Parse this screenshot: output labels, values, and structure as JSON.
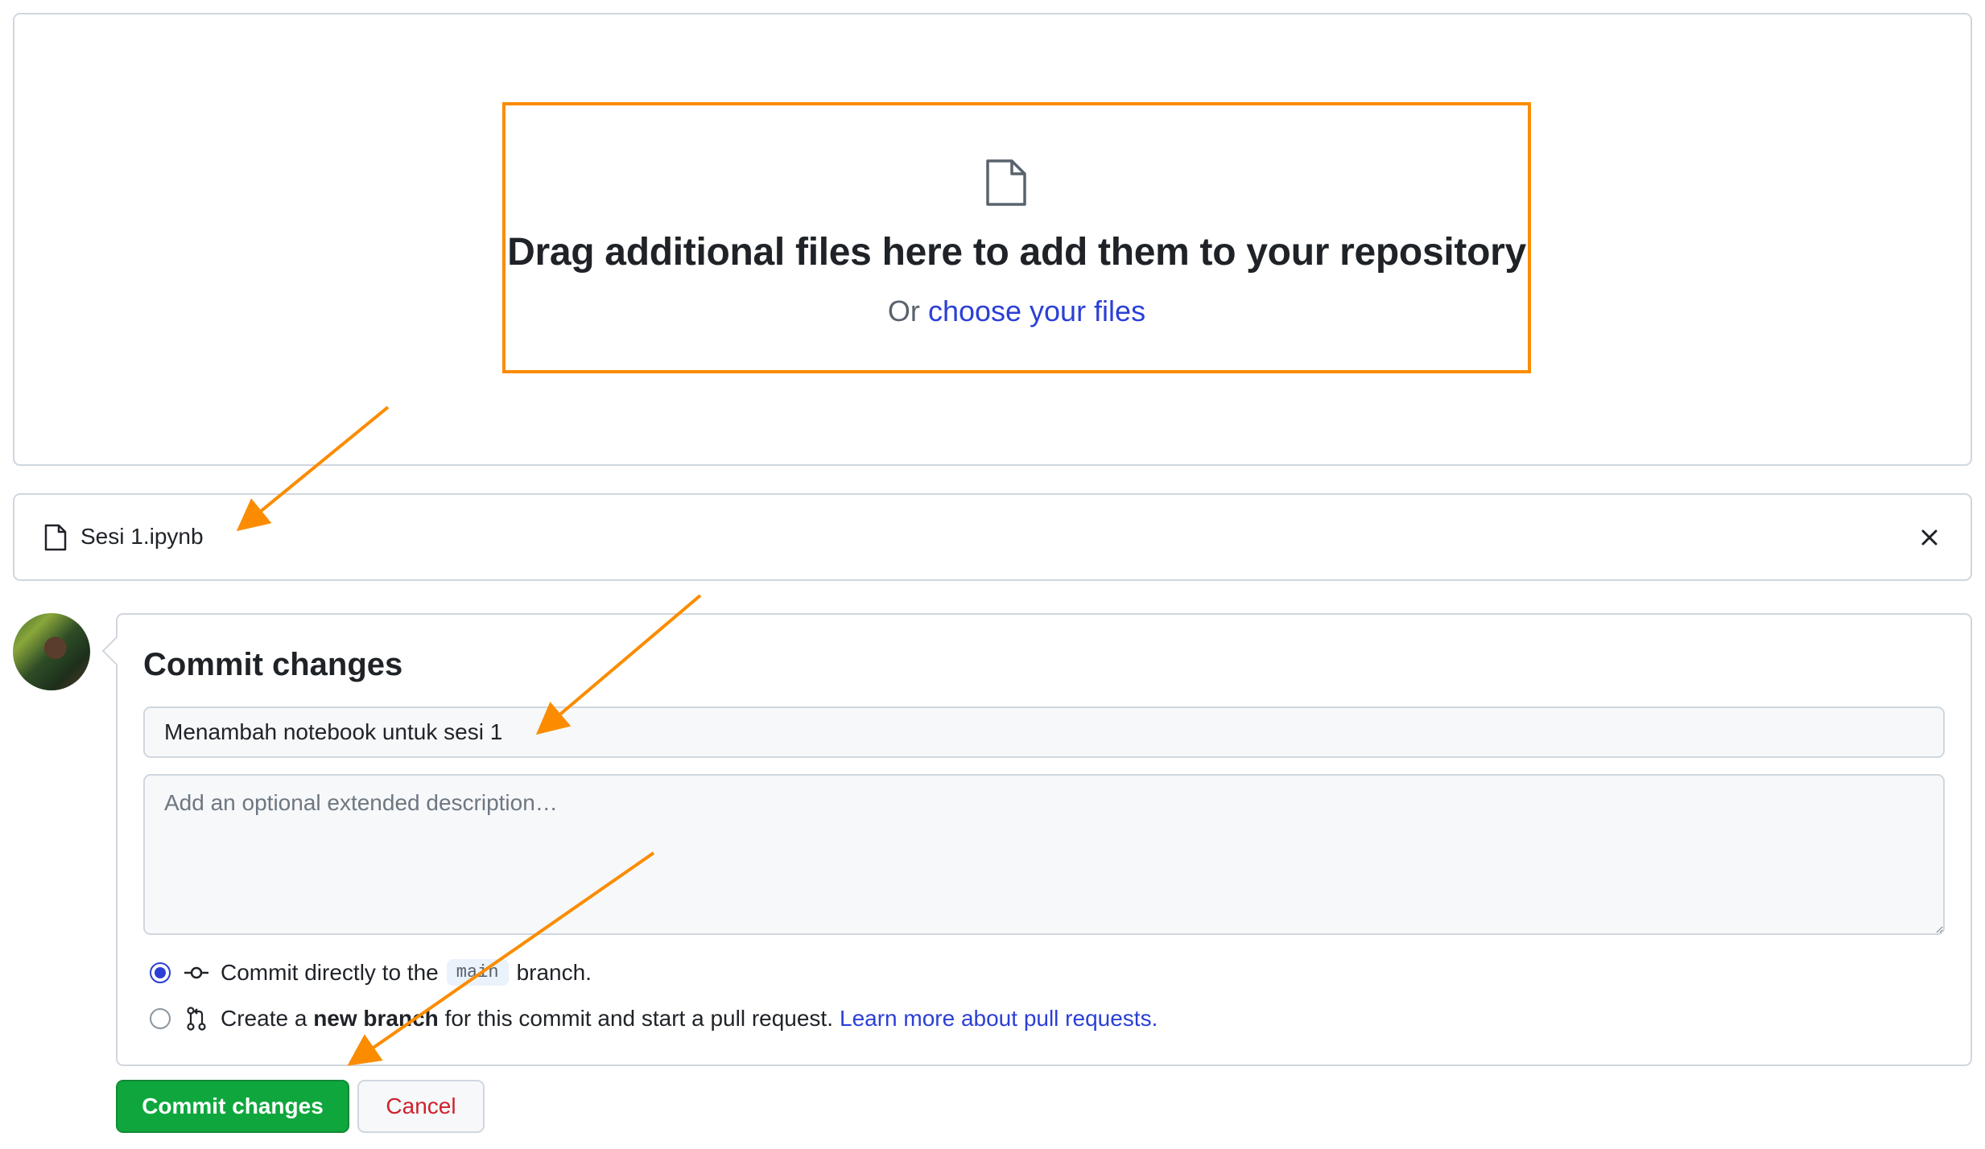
{
  "dropzone": {
    "title": "Drag additional files here to add them to your repository",
    "prefix": "Or",
    "link": "choose your files"
  },
  "file": {
    "name": "Sesi 1.ipynb"
  },
  "commit": {
    "heading": "Commit changes",
    "summary_value": "Menambah notebook untuk sesi 1",
    "description_placeholder": "Add an optional extended description…",
    "option_direct": {
      "before": "Commit directly to the",
      "branch": "main",
      "after": "branch."
    },
    "option_new": {
      "before": "Create a",
      "bold": "new branch",
      "after": "for this commit and start a pull request.",
      "link": "Learn more about pull requests."
    },
    "submit_label": "Commit changes",
    "cancel_label": "Cancel"
  },
  "colors": {
    "highlight": "#fb8c00",
    "accent_link": "#2b3fd6",
    "commit_button": "#0fa73d",
    "cancel_text": "#cf222e"
  },
  "icons": {
    "dropzone": "file-icon",
    "file_row": "file-icon",
    "remove": "close-icon",
    "commit_direct": "git-commit-icon",
    "commit_branch": "git-pull-request-icon"
  }
}
